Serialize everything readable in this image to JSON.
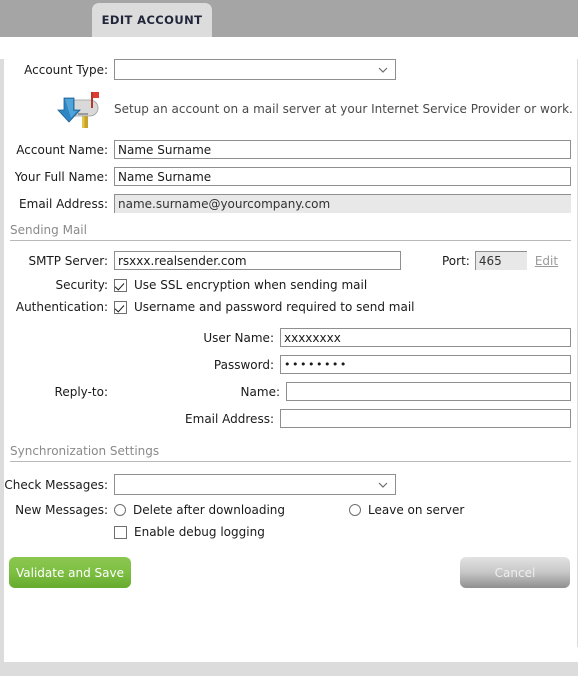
{
  "tab": {
    "label": "EDIT ACCOUNT"
  },
  "form": {
    "account_type": {
      "label": "Account Type:",
      "value": "",
      "placeholder": "",
      "icon": "chevron-down-icon"
    },
    "hint": {
      "icon": "mailbox-download-icon",
      "text": "Setup an account on a mail server at your Internet Service Provider or work."
    },
    "account_name": {
      "label": "Account Name:",
      "value": "Name Surname"
    },
    "full_name": {
      "label": "Your Full Name:",
      "value": "Name Surname"
    },
    "email_address": {
      "label": "Email Address:",
      "value": "name.surname@yourcompany.com",
      "readonly": true
    }
  },
  "sending_mail": {
    "section_title": "Sending Mail",
    "smtp_server": {
      "label": "SMTP Server:",
      "value": "rsxxx.realsender.com"
    },
    "port": {
      "label": "Port:",
      "value": "465",
      "edit_link": "Edit",
      "readonly": true
    },
    "security": {
      "label": "Security:",
      "option": "Use SSL encryption when sending mail",
      "checked": true
    },
    "authentication": {
      "label": "Authentication:",
      "option": "Username and password required to send mail",
      "checked": true
    },
    "user_name": {
      "label": "User Name:",
      "value": "xxxxxxxx"
    },
    "password": {
      "label": "Password:",
      "value": "••••••••"
    },
    "reply_to": {
      "label": "Reply-to:",
      "name": {
        "label": "Name:",
        "value": ""
      },
      "email": {
        "label": "Email Address:",
        "value": ""
      }
    }
  },
  "sync_settings": {
    "section_title": "Synchronization Settings",
    "check_messages": {
      "label": "Check Messages:",
      "value": "",
      "icon": "chevron-down-icon"
    },
    "new_messages": {
      "label": "New Messages:",
      "options": [
        {
          "label": "Delete after downloading",
          "selected": false
        },
        {
          "label": "Leave on server",
          "selected": false
        }
      ]
    },
    "debug_logging": {
      "label": "Enable debug logging",
      "checked": false
    }
  },
  "buttons": {
    "save": {
      "label": "Validate and Save",
      "color": "#7dbf42"
    },
    "cancel": {
      "label": "Cancel",
      "color": "#c8c8c8"
    }
  }
}
